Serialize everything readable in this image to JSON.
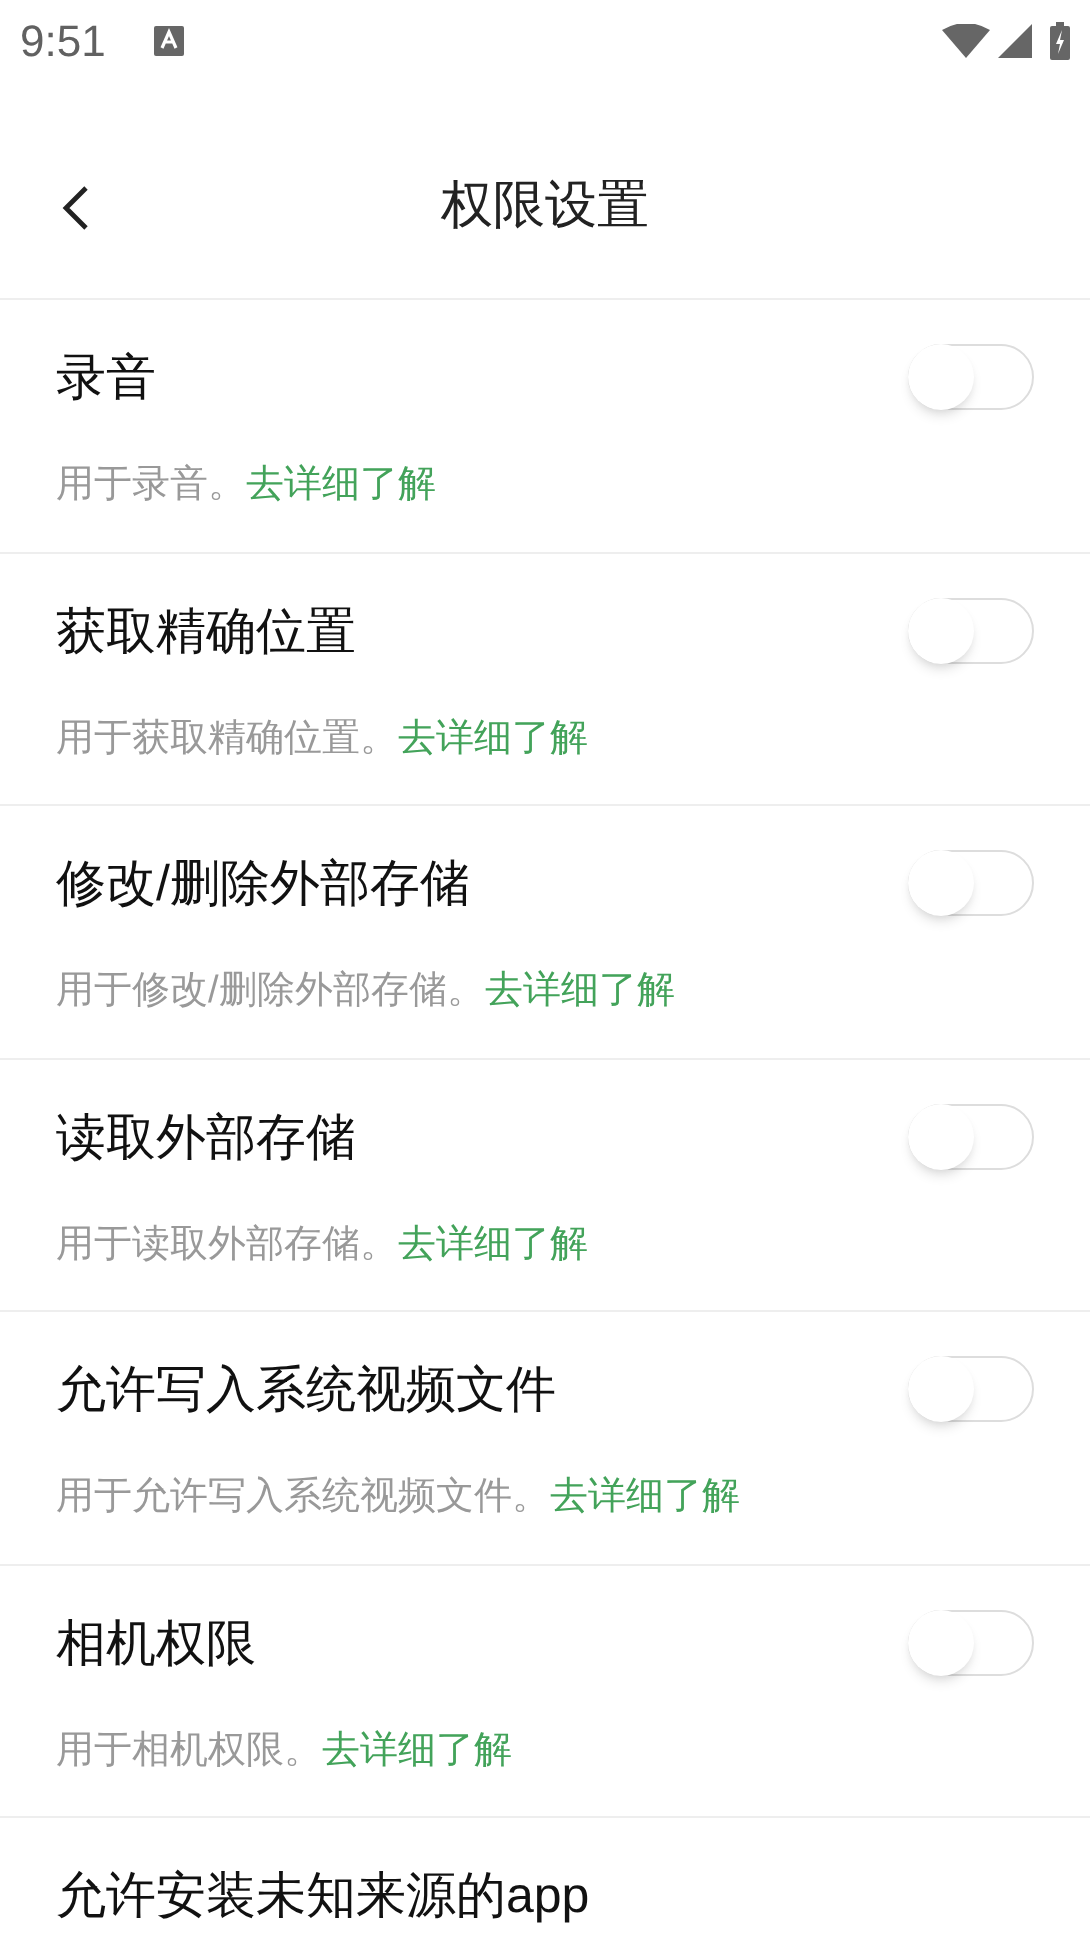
{
  "status_bar": {
    "time": "9:51"
  },
  "header": {
    "title": "权限设置"
  },
  "permissions": [
    {
      "title": "录音",
      "on": false,
      "description": "用于录音。",
      "link": "去详细了解"
    },
    {
      "title": "获取精确位置",
      "on": false,
      "description": "用于获取精确位置。",
      "link": "去详细了解"
    },
    {
      "title": "修改/删除外部存储",
      "on": false,
      "description": "用于修改/删除外部存储。",
      "link": "去详细了解"
    },
    {
      "title": "读取外部存储",
      "on": false,
      "description": "用于读取外部存储。",
      "link": "去详细了解"
    },
    {
      "title": "允许写入系统视频文件",
      "on": false,
      "description": "用于允许写入系统视频文件。",
      "link": "去详细了解"
    },
    {
      "title": "相机权限",
      "on": false,
      "description": "用于相机权限。",
      "link": "去详细了解"
    },
    {
      "title": "允许安装未知来源的app"
    }
  ]
}
